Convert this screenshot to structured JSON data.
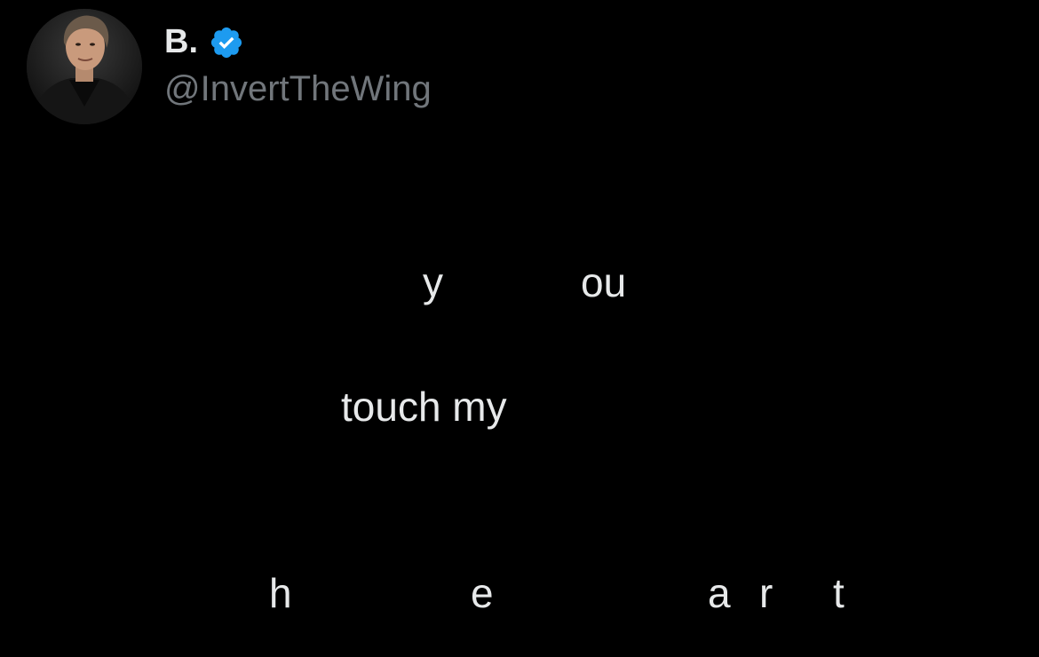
{
  "author": {
    "display_name": "B.",
    "handle": "@InvertTheWing",
    "verified": true,
    "verified_icon": "verified-badge-icon",
    "avatar_icon": "avatar-photo"
  },
  "tweet": {
    "fragments": {
      "y": "y",
      "ou": "ou",
      "touch_my": "touch my",
      "h": "h",
      "e": "e",
      "a": "a",
      "r": "r",
      "t": "t"
    }
  },
  "colors": {
    "background": "#000000",
    "text_primary": "#e7e9ea",
    "text_secondary": "#71767b",
    "verified_blue": "#1d9bf0"
  }
}
